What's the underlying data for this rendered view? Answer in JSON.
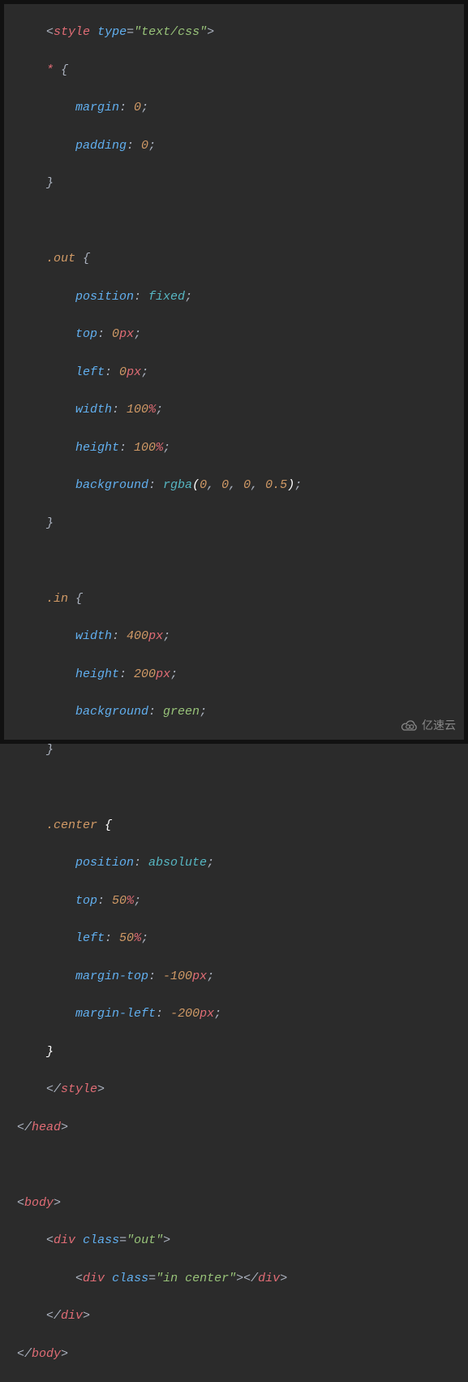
{
  "code": {
    "l1": {
      "open": "<",
      "tag": "style",
      "sp": " ",
      "attr": "type",
      "eq": "=",
      "q": "\"",
      "val": "text/css",
      "close": ">"
    },
    "l2": {
      "sel": "*",
      "sp": " ",
      "brace": "{"
    },
    "l3": {
      "prop": "margin",
      "colon": ": ",
      "val": "0",
      "semi": ";"
    },
    "l4": {
      "prop": "padding",
      "colon": ": ",
      "val": "0",
      "semi": ";"
    },
    "l5": {
      "brace": "}"
    },
    "l6": {
      "sel": ".out",
      "sp": " ",
      "brace": "{"
    },
    "l7": {
      "prop": "position",
      "colon": ": ",
      "val": "fixed",
      "semi": ";"
    },
    "l8": {
      "prop": "top",
      "colon": ": ",
      "val": "0",
      "unit": "px",
      "semi": ";"
    },
    "l9": {
      "prop": "left",
      "colon": ": ",
      "val": "0",
      "unit": "px",
      "semi": ";"
    },
    "l10": {
      "prop": "width",
      "colon": ": ",
      "val": "100",
      "unit": "%",
      "semi": ";"
    },
    "l11": {
      "prop": "height",
      "colon": ": ",
      "val": "100",
      "unit": "%",
      "semi": ";"
    },
    "l12": {
      "prop": "background",
      "colon": ": ",
      "func": "rgba",
      "p1": "(",
      "a": "0",
      "c": ", ",
      "b": "0",
      "cc": ", ",
      "d": "0",
      "ccc": ", ",
      "e": "0.5",
      "p2": ")",
      "semi": ";"
    },
    "l13": {
      "brace": "}"
    },
    "l14": {
      "sel": ".in",
      "sp": " ",
      "brace": "{"
    },
    "l15": {
      "prop": "width",
      "colon": ": ",
      "val": "400",
      "unit": "px",
      "semi": ";"
    },
    "l16": {
      "prop": "height",
      "colon": ": ",
      "val": "200",
      "unit": "px",
      "semi": ";"
    },
    "l17": {
      "prop": "background",
      "colon": ": ",
      "val": "green",
      "semi": ";"
    },
    "l18": {
      "brace": "}"
    },
    "l19": {
      "sel": ".center",
      "sp": " ",
      "brace": "{"
    },
    "l20": {
      "prop": "position",
      "colon": ": ",
      "val": "absolute",
      "semi": ";"
    },
    "l21": {
      "prop": "top",
      "colon": ": ",
      "val": "50",
      "unit": "%",
      "semi": ";"
    },
    "l22": {
      "prop": "left",
      "colon": ": ",
      "val": "50",
      "unit": "%",
      "semi": ";"
    },
    "l23": {
      "prop": "margin-top",
      "colon": ": ",
      "val": "-100",
      "unit": "px",
      "semi": ";"
    },
    "l24": {
      "prop": "margin-left",
      "colon": ": ",
      "val": "-200",
      "unit": "px",
      "semi": ";"
    },
    "l25": {
      "brace": "}"
    },
    "l26": {
      "open": "</",
      "tag": "style",
      "close": ">"
    },
    "l27": {
      "open": "</",
      "tag": "head",
      "close": ">"
    },
    "l28": {
      "open": "<",
      "tag": "body",
      "close": ">"
    },
    "l29": {
      "open": "<",
      "tag": "div",
      "sp": " ",
      "attr": "class",
      "eq": "=",
      "q": "\"",
      "val": "out",
      "close": ">"
    },
    "l30": {
      "open": "<",
      "tag": "div",
      "sp": " ",
      "attr": "class",
      "eq": "=",
      "q": "\"",
      "val": "in center",
      "close": ">",
      "open2": "</",
      "tag2": "div",
      "close2": ">"
    },
    "l31": {
      "open": "</",
      "tag": "div",
      "close": ">"
    },
    "l32": {
      "open": "</",
      "tag": "body",
      "close": ">"
    }
  },
  "watermark": {
    "text": "亿速云"
  }
}
